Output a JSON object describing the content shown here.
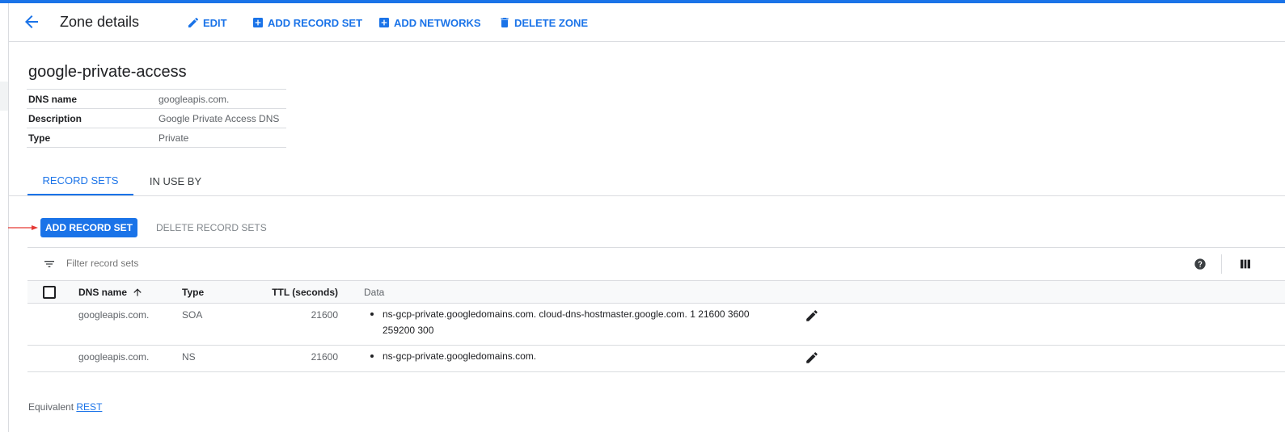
{
  "header": {
    "title": "Zone details",
    "actions": {
      "edit": "EDIT",
      "add_record_set": "ADD RECORD SET",
      "add_networks": "ADD NETWORKS",
      "delete_zone": "DELETE ZONE"
    }
  },
  "zone": {
    "name": "google-private-access",
    "properties": [
      {
        "key": "DNS name",
        "value": "googleapis.com."
      },
      {
        "key": "Description",
        "value": "Google Private Access DNS"
      },
      {
        "key": "Type",
        "value": "Private"
      }
    ]
  },
  "tabs": [
    {
      "label": "RECORD SETS",
      "active": true
    },
    {
      "label": "IN USE BY",
      "active": false
    }
  ],
  "toolbar": {
    "add_record_set": "ADD RECORD SET",
    "delete_record_sets": "DELETE RECORD SETS"
  },
  "filter": {
    "placeholder": "Filter record sets"
  },
  "table": {
    "headers": {
      "dns_name": "DNS name",
      "type": "Type",
      "ttl": "TTL (seconds)",
      "data": "Data"
    },
    "rows": [
      {
        "dns_name": "googleapis.com.",
        "type": "SOA",
        "ttl": "21600",
        "data": "ns-gcp-private.googledomains.com. cloud-dns-hostmaster.google.com. 1 21600 3600 259200 300"
      },
      {
        "dns_name": "googleapis.com.",
        "type": "NS",
        "ttl": "21600",
        "data": "ns-gcp-private.googledomains.com."
      }
    ]
  },
  "footer": {
    "prefix": "Equivalent",
    "link": "REST"
  },
  "colors": {
    "accent": "#1a73e8",
    "annotation_arrow": "#e53935"
  },
  "icons": [
    "arrow-back-icon",
    "pencil-icon",
    "plus-box-icon",
    "trash-icon",
    "filter-icon",
    "help-icon",
    "columns-icon",
    "arrow-up-icon"
  ]
}
